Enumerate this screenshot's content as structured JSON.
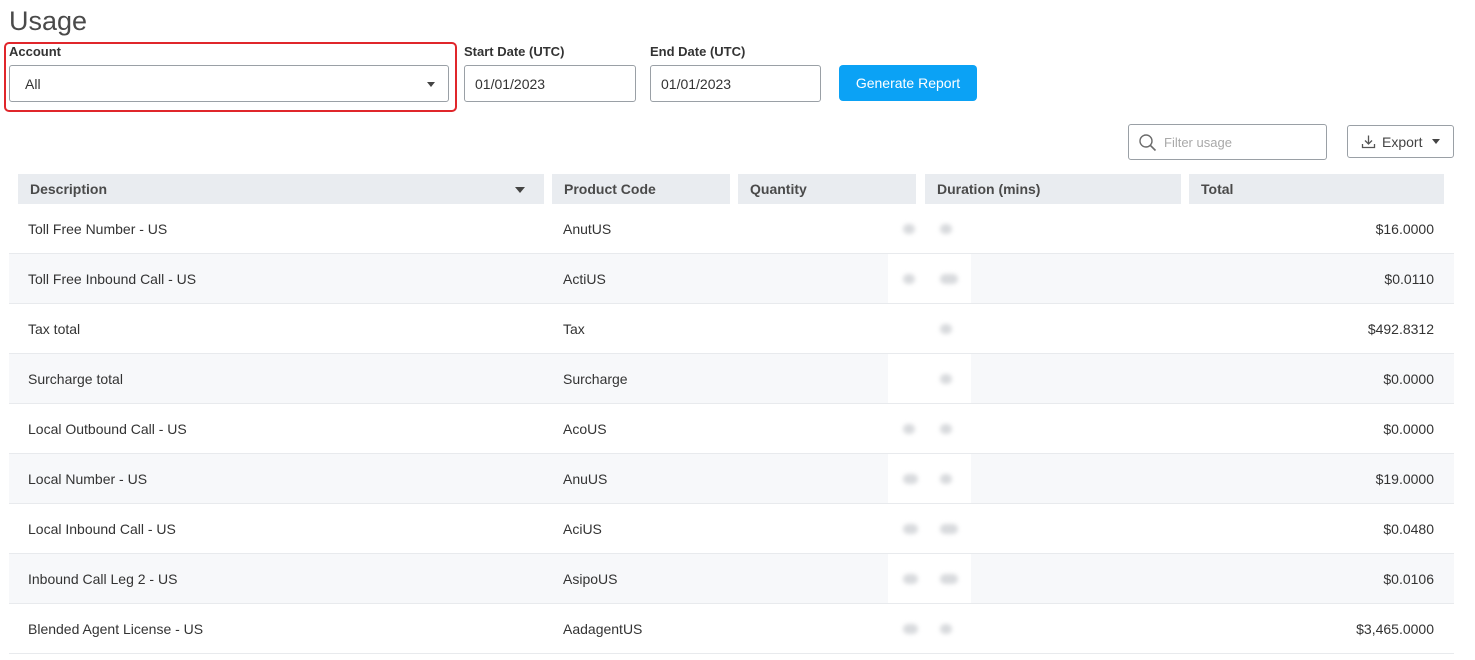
{
  "page": {
    "title": "Usage"
  },
  "filters": {
    "account_label": "Account",
    "account_value": "All",
    "start_date_label": "Start Date (UTC)",
    "start_date_value": "01/01/2023",
    "end_date_label": "End Date (UTC)",
    "end_date_value": "01/01/2023",
    "generate_button": "Generate Report"
  },
  "toolbar": {
    "filter_placeholder": "Filter usage",
    "export_label": "Export"
  },
  "table": {
    "columns": [
      "Description",
      "Product Code",
      "Quantity",
      "Duration (mins)",
      "Total"
    ],
    "rows": [
      {
        "description": "Toll Free Number - US",
        "code": "AnutUS",
        "total": "$16.0000"
      },
      {
        "description": "Toll Free Inbound Call - US",
        "code": "ActiUS",
        "total": "$0.0110"
      },
      {
        "description": "Tax total",
        "code": "Tax",
        "total": "$492.8312"
      },
      {
        "description": "Surcharge total",
        "code": "Surcharge",
        "total": "$0.0000"
      },
      {
        "description": "Local Outbound Call - US",
        "code": "AcoUS",
        "total": "$0.0000"
      },
      {
        "description": "Local Number - US",
        "code": "AnuUS",
        "total": "$19.0000"
      },
      {
        "description": "Local Inbound Call - US",
        "code": "AciUS",
        "total": "$0.0480"
      },
      {
        "description": "Inbound Call Leg 2 - US",
        "code": "AsipoUS",
        "total": "$0.0106"
      },
      {
        "description": "Blended Agent License - US",
        "code": "AadagentUS",
        "total": "$3,465.0000"
      }
    ]
  },
  "colors": {
    "accent": "#0ba2f5",
    "highlight": "#e0262b",
    "header_bg": "#e9ecf0"
  }
}
